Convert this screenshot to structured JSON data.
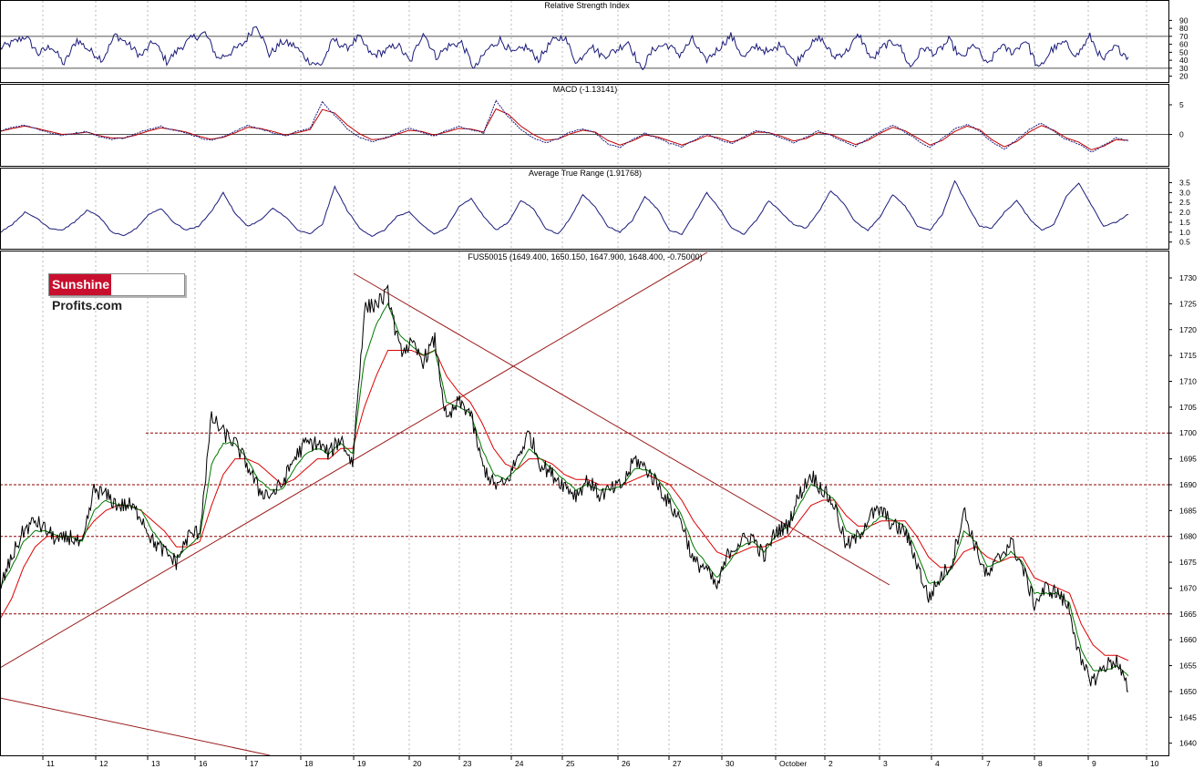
{
  "colors": {
    "rsi": "#1a1a7a",
    "macd_line": "#1a1a7a",
    "macd_signal": "#c00000",
    "atr": "#1a1a7a",
    "price": "#000000",
    "ma_short": "#007700",
    "ma_long": "#dd0000",
    "trend": "#9b1c1c",
    "level": "#8b0000",
    "grid": "#b8b8b8",
    "logo_red": "#c8102e"
  },
  "logo": {
    "part1": "Sunshine",
    "part2": "Profits.com"
  },
  "chart_data": [
    {
      "type": "line",
      "title": "Relative Strength Index",
      "y_ticks": [
        "90",
        "80",
        "70",
        "60",
        "50",
        "40",
        "30",
        "20"
      ],
      "ylim": [
        15,
        95
      ],
      "reference_lines": [
        70,
        30
      ],
      "series": [
        {
          "values": [
            55,
            62,
            70,
            48,
            58,
            35,
            66,
            52,
            41,
            72,
            60,
            45,
            64,
            38,
            55,
            68,
            74,
            42,
            50,
            61,
            86,
            47,
            63,
            58,
            40,
            33,
            66,
            55,
            69,
            46,
            51,
            60,
            37,
            76,
            44,
            58,
            62,
            29,
            53,
            66,
            48,
            57,
            41,
            63,
            70,
            36,
            59,
            45,
            52,
            64,
            28,
            55,
            60,
            47,
            66,
            39,
            54,
            71,
            43,
            58,
            49,
            62,
            35,
            57,
            68,
            44,
            51,
            72,
            40,
            59,
            63,
            31,
            56,
            48,
            65,
            42,
            60,
            33,
            58,
            50,
            66,
            28,
            53,
            62,
            46,
            70,
            39,
            57,
            44
          ]
        }
      ]
    },
    {
      "type": "line",
      "title": "MACD (-1.13141)",
      "y_ticks": [
        "5",
        "0"
      ],
      "ylim": [
        -5,
        7
      ],
      "reference_lines": [
        0
      ],
      "series": [
        {
          "values": [
            0.6,
            1.2,
            1.6,
            0.9,
            0.3,
            -0.2,
            0.2,
            0.5,
            -0.4,
            -0.8,
            -0.6,
            0.1,
            0.9,
            1.4,
            0.7,
            0.3,
            -0.5,
            -1.0,
            -0.4,
            0.6,
            1.5,
            0.9,
            0.3,
            -0.3,
            0.5,
            1.0,
            5.5,
            3.2,
            1.0,
            -0.5,
            -1.2,
            -0.6,
            0.2,
            1.0,
            0.4,
            -0.3,
            0.6,
            1.3,
            0.8,
            0.2,
            5.7,
            3.0,
            0.8,
            -0.6,
            -1.4,
            -0.7,
            0.4,
            0.9,
            0.3,
            -1.6,
            -2.2,
            -0.9,
            0.2,
            -0.6,
            -1.5,
            -2.1,
            -0.9,
            0.1,
            -0.8,
            -1.6,
            -0.4,
            0.7,
            0.2,
            -0.6,
            -1.4,
            -0.5,
            0.6,
            -0.2,
            -1.2,
            -2.0,
            -0.8,
            0.5,
            1.6,
            0.4,
            -1.0,
            -2.2,
            -0.7,
            0.9,
            1.7,
            0.6,
            -1.3,
            -2.5,
            -0.9,
            0.8,
            1.9,
            0.5,
            -0.9,
            -1.6,
            -3.0,
            -1.8,
            -0.6,
            -1.1
          ]
        },
        {
          "values": [
            0.5,
            1.0,
            1.4,
            1.0,
            0.5,
            0.0,
            0.1,
            0.4,
            -0.2,
            -0.6,
            -0.6,
            -0.1,
            0.6,
            1.1,
            0.8,
            0.4,
            -0.3,
            -0.8,
            -0.5,
            0.3,
            1.2,
            1.0,
            0.5,
            -0.1,
            0.3,
            0.8,
            4.2,
            3.6,
            1.6,
            0.1,
            -0.9,
            -0.7,
            0.0,
            0.7,
            0.5,
            -0.1,
            0.4,
            1.0,
            0.9,
            0.4,
            4.3,
            3.4,
            1.4,
            0.0,
            -1.0,
            -0.8,
            0.1,
            0.7,
            0.4,
            -1.0,
            -1.8,
            -1.1,
            -0.1,
            -0.4,
            -1.1,
            -1.8,
            -1.1,
            -0.2,
            -0.6,
            -1.3,
            -0.6,
            0.4,
            0.3,
            -0.3,
            -1.1,
            -0.7,
            0.3,
            0.0,
            -0.9,
            -1.7,
            -1.0,
            0.2,
            1.2,
            0.6,
            -0.6,
            -1.8,
            -1.0,
            0.5,
            1.4,
            0.8,
            -0.9,
            -2.1,
            -1.2,
            0.4,
            1.5,
            0.7,
            -0.6,
            -1.3,
            -2.6,
            -2.0,
            -0.9,
            -1.0
          ]
        }
      ]
    },
    {
      "type": "line",
      "title": "Average True Range (1.91768)",
      "y_ticks": [
        "3.5",
        "3.0",
        "2.5",
        "2.0",
        "1.5",
        "1.0",
        "0.5"
      ],
      "ylim": [
        0.3,
        3.8
      ],
      "series": [
        {
          "values": [
            1.0,
            1.4,
            2.0,
            1.7,
            1.2,
            1.1,
            1.5,
            2.1,
            1.8,
            1.0,
            0.8,
            1.2,
            1.9,
            2.2,
            1.5,
            1.1,
            1.3,
            2.0,
            3.0,
            1.9,
            1.3,
            1.6,
            2.2,
            1.8,
            1.1,
            0.9,
            1.4,
            3.3,
            2.1,
            1.2,
            0.8,
            1.1,
            1.8,
            2.0,
            1.4,
            0.9,
            1.2,
            2.3,
            2.7,
            1.8,
            1.1,
            1.5,
            2.6,
            2.2,
            1.2,
            0.9,
            1.7,
            2.9,
            2.3,
            1.3,
            1.0,
            1.6,
            2.8,
            2.2,
            1.1,
            0.9,
            1.9,
            3.0,
            2.2,
            1.2,
            0.9,
            1.6,
            2.6,
            2.0,
            1.4,
            1.2,
            2.0,
            3.1,
            2.5,
            1.5,
            1.1,
            1.8,
            2.9,
            2.3,
            1.3,
            1.1,
            1.9,
            3.6,
            2.4,
            1.3,
            1.2,
            2.0,
            2.6,
            1.7,
            1.1,
            1.4,
            2.8,
            3.5,
            2.4,
            1.3,
            1.5,
            1.9
          ]
        }
      ]
    },
    {
      "type": "line",
      "title": "FUS50015 (1649.400, 1650.150, 1647.900, 1648.400, -0.75000)",
      "y_ticks": [
        "1730",
        "1725",
        "1720",
        "1715",
        "1710",
        "1705",
        "1700",
        "1695",
        "1690",
        "1685",
        "1680",
        "1675",
        "1670",
        "1665",
        "1660",
        "1655",
        "1650",
        "1645",
        "1640"
      ],
      "ylim": [
        1638,
        1733
      ],
      "x_ticks": [
        "11",
        "12",
        "13",
        "16",
        "17",
        "18",
        "19",
        "20",
        "23",
        "24",
        "25",
        "26",
        "27",
        "30",
        "October",
        "2",
        "3",
        "4",
        "7",
        "8",
        "9",
        "10"
      ],
      "reference_lines": [
        1700,
        1690,
        1680,
        1665
      ],
      "series": [
        {
          "name": "price",
          "values": [
            1670,
            1676,
            1681,
            1683,
            1681,
            1679,
            1680,
            1678,
            1689,
            1688,
            1686,
            1686,
            1684,
            1679,
            1677,
            1675,
            1680,
            1681,
            1703,
            1700,
            1698,
            1694,
            1689,
            1688,
            1690,
            1695,
            1698,
            1698,
            1696,
            1699,
            1694,
            1724,
            1725,
            1727,
            1716,
            1717,
            1714,
            1718,
            1702,
            1706,
            1704,
            1694,
            1690,
            1690,
            1695,
            1700,
            1694,
            1692,
            1690,
            1688,
            1691,
            1688,
            1689,
            1690,
            1695,
            1693,
            1690,
            1686,
            1683,
            1675,
            1674,
            1670,
            1677,
            1679,
            1680,
            1676,
            1681,
            1682,
            1688,
            1692,
            1689,
            1686,
            1678,
            1680,
            1684,
            1685,
            1682,
            1681,
            1675,
            1668,
            1672,
            1675,
            1685,
            1678,
            1672,
            1676,
            1679,
            1674,
            1667,
            1670,
            1669,
            1666,
            1655,
            1652,
            1655,
            1656,
            1650
          ]
        },
        {
          "name": "ma_short",
          "values": [
            1670,
            1674,
            1679,
            1681,
            1681,
            1680,
            1680,
            1679,
            1685,
            1687,
            1686,
            1686,
            1685,
            1681,
            1678,
            1676,
            1678,
            1680,
            1694,
            1698,
            1698,
            1695,
            1691,
            1689,
            1689,
            1693,
            1696,
            1697,
            1696,
            1698,
            1696,
            1714,
            1721,
            1725,
            1719,
            1717,
            1715,
            1716,
            1706,
            1705,
            1704,
            1697,
            1692,
            1691,
            1693,
            1697,
            1695,
            1693,
            1691,
            1689,
            1690,
            1689,
            1689,
            1690,
            1693,
            1693,
            1691,
            1688,
            1684,
            1678,
            1675,
            1672,
            1675,
            1678,
            1679,
            1677,
            1680,
            1682,
            1686,
            1690,
            1689,
            1687,
            1681,
            1680,
            1682,
            1684,
            1683,
            1682,
            1677,
            1671,
            1671,
            1674,
            1681,
            1679,
            1674,
            1675,
            1677,
            1675,
            1669,
            1669,
            1669,
            1667,
            1658,
            1654,
            1654,
            1655,
            1653
          ]
        },
        {
          "name": "ma_long",
          "values": [
            1664,
            1668,
            1674,
            1678,
            1680,
            1680,
            1680,
            1680,
            1683,
            1685,
            1686,
            1686,
            1685,
            1683,
            1681,
            1678,
            1678,
            1679,
            1686,
            1692,
            1695,
            1695,
            1694,
            1692,
            1690,
            1691,
            1693,
            1695,
            1695,
            1697,
            1697,
            1705,
            1711,
            1716,
            1716,
            1716,
            1715,
            1716,
            1711,
            1708,
            1706,
            1702,
            1697,
            1694,
            1693,
            1695,
            1695,
            1694,
            1692,
            1691,
            1691,
            1690,
            1690,
            1690,
            1691,
            1692,
            1691,
            1690,
            1687,
            1683,
            1680,
            1677,
            1676,
            1677,
            1678,
            1678,
            1679,
            1680,
            1683,
            1686,
            1687,
            1687,
            1684,
            1682,
            1682,
            1683,
            1683,
            1683,
            1680,
            1676,
            1674,
            1674,
            1677,
            1678,
            1676,
            1675,
            1676,
            1676,
            1672,
            1671,
            1670,
            1669,
            1663,
            1659,
            1657,
            1657,
            1656
          ]
        }
      ]
    }
  ]
}
